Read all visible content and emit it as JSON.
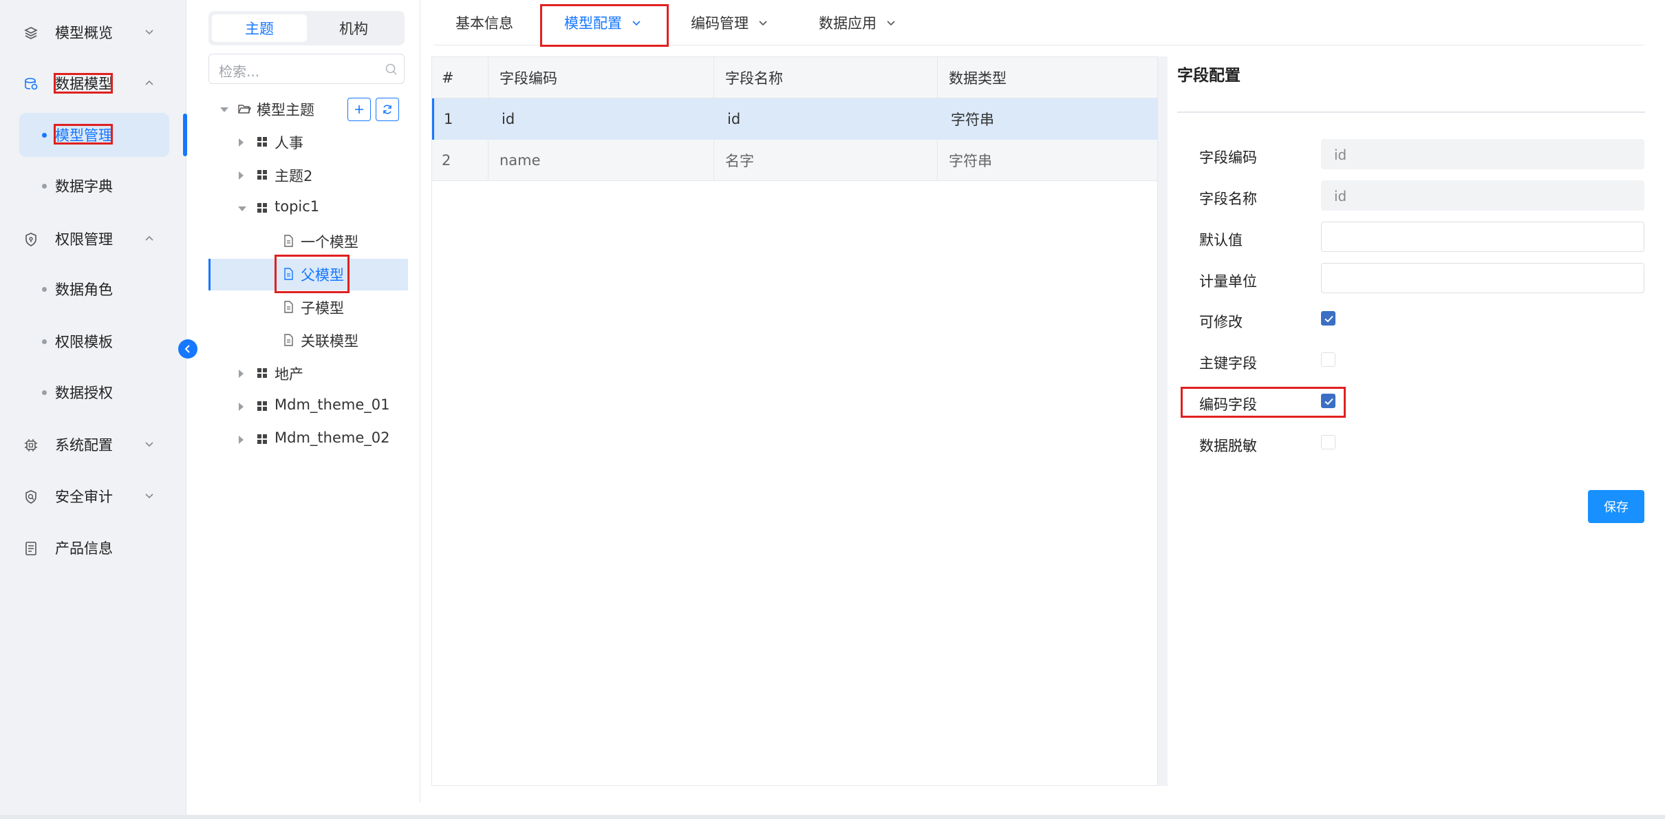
{
  "sidebar": {
    "items": [
      {
        "label": "模型概览",
        "icon": "layers-icon"
      },
      {
        "label": "数据模型",
        "icon": "database-icon"
      },
      {
        "label": "权限管理",
        "icon": "shield-icon"
      },
      {
        "label": "系统配置",
        "icon": "chip-icon"
      },
      {
        "label": "安全审计",
        "icon": "audit-shield-icon"
      },
      {
        "label": "产品信息",
        "icon": "document-list-icon"
      }
    ],
    "sub_data_model": [
      {
        "label": "模型管理",
        "active": true
      },
      {
        "label": "数据字典",
        "active": false
      }
    ],
    "sub_permission": [
      {
        "label": "数据角色"
      },
      {
        "label": "权限模板"
      },
      {
        "label": "数据授权"
      }
    ]
  },
  "tree": {
    "segments": [
      "主题",
      "机构"
    ],
    "search_placeholder": "检索...",
    "root_label": "模型主题",
    "nodes": [
      {
        "label": "人事"
      },
      {
        "label": "主题2"
      },
      {
        "label": "topic1"
      },
      {
        "label": "一个模型"
      },
      {
        "label": "父模型",
        "selected": true
      },
      {
        "label": "子模型"
      },
      {
        "label": "关联模型"
      },
      {
        "label": "地产"
      },
      {
        "label": "Mdm_theme_01"
      },
      {
        "label": "Mdm_theme_02"
      }
    ]
  },
  "tabs": [
    {
      "label": "基本信息",
      "active": false
    },
    {
      "label": "模型配置",
      "active": true
    },
    {
      "label": "编码管理",
      "active": false
    },
    {
      "label": "数据应用",
      "active": false
    }
  ],
  "grid": {
    "headers": [
      "#",
      "字段编码",
      "字段名称",
      "数据类型"
    ],
    "rows": [
      [
        "1",
        "id",
        "id",
        "字符串"
      ],
      [
        "2",
        "name",
        "名字",
        "字符串"
      ]
    ]
  },
  "field_config": {
    "title": "字段配置",
    "code_label": "字段编码",
    "code_value": "id",
    "name_label": "字段名称",
    "name_value": "id",
    "default_label": "默认值",
    "default_value": "",
    "unit_label": "计量单位",
    "unit_value": "",
    "editable_label": "可修改",
    "editable_checked": true,
    "pk_label": "主键字段",
    "pk_checked": false,
    "coding_label": "编码字段",
    "coding_checked": true,
    "mask_label": "数据脱敏",
    "mask_checked": false,
    "save_label": "保存"
  },
  "colors": {
    "accent": "#1677ff",
    "highlight_box": "#e02020",
    "checkbox_checked": "#3a6fc4",
    "selected_row_bg": "#dbe9f9"
  }
}
